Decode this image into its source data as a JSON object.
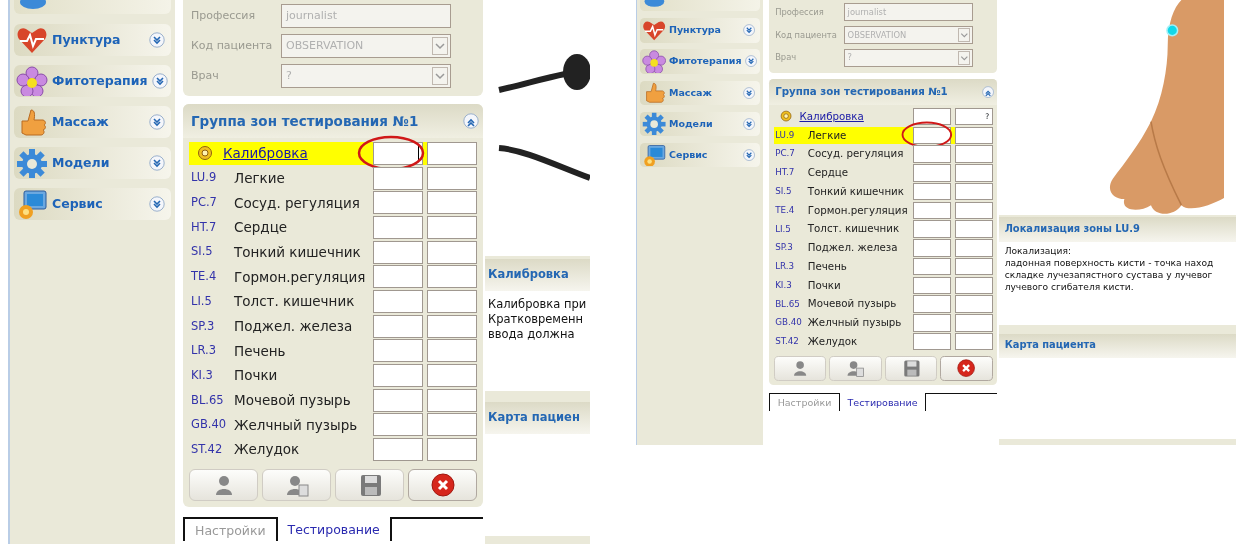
{
  "panels": [
    {
      "sidebar": {
        "items": [
          {
            "label": "Пунктура",
            "expanded": false
          },
          {
            "label": "Фитотерапия",
            "expanded": false
          },
          {
            "label": "Массаж",
            "expanded": false
          },
          {
            "label": "Модели",
            "expanded": false
          },
          {
            "label": "Сервис",
            "expanded": false
          }
        ]
      },
      "patient_form": {
        "fields": [
          {
            "label": "Профессия",
            "value": "journalist",
            "kind": "text",
            "disabled": true
          },
          {
            "label": "Код пациента",
            "value": "OBSERVATION",
            "kind": "select",
            "disabled": true
          },
          {
            "label": "Врач",
            "value": "?",
            "kind": "select",
            "disabled": true
          }
        ]
      },
      "test_group": {
        "title": "Группа зон тестирования №1",
        "expanded": true,
        "rows": [
          {
            "kind": "calibration",
            "label": "Калибровка",
            "highlighted": true,
            "circled": true,
            "focused": true
          },
          {
            "kind": "zone",
            "code": "LU.9",
            "name": "Легкие",
            "highlighted": false,
            "circled": false,
            "focused": false
          },
          {
            "kind": "zone",
            "code": "PC.7",
            "name": "Сосуд. регуляция",
            "highlighted": false,
            "circled": false,
            "focused": false
          },
          {
            "kind": "zone",
            "code": "HT.7",
            "name": "Сердце",
            "highlighted": false,
            "circled": false,
            "focused": false
          },
          {
            "kind": "zone",
            "code": "SI.5",
            "name": "Тонкий кишечник",
            "highlighted": false,
            "circled": false,
            "focused": false
          },
          {
            "kind": "zone",
            "code": "TE.4",
            "name": "Гормон.регуляция",
            "highlighted": false,
            "circled": false,
            "focused": false
          },
          {
            "kind": "zone",
            "code": "LI.5",
            "name": "Толст. кишечник",
            "highlighted": false,
            "circled": false,
            "focused": false
          },
          {
            "kind": "zone",
            "code": "SP.3",
            "name": "Поджел. железа",
            "highlighted": false,
            "circled": false,
            "focused": false
          },
          {
            "kind": "zone",
            "code": "LR.3",
            "name": "Печень",
            "highlighted": false,
            "circled": false,
            "focused": false
          },
          {
            "kind": "zone",
            "code": "KI.3",
            "name": "Почки",
            "highlighted": false,
            "circled": false,
            "focused": false
          },
          {
            "kind": "zone",
            "code": "BL.65",
            "name": "Мочевой пузырь",
            "highlighted": false,
            "circled": false,
            "focused": false
          },
          {
            "kind": "zone",
            "code": "GB.40",
            "name": "Желчный пузырь",
            "highlighted": false,
            "circled": false,
            "focused": false
          },
          {
            "kind": "zone",
            "code": "ST.42",
            "name": "Желудок",
            "highlighted": false,
            "circled": false,
            "focused": false
          }
        ]
      },
      "picture": {
        "kind": "cable"
      },
      "info_panels": [
        {
          "title": "Калибровка",
          "lines": [
            "Калибровка при",
            "Кратковременн",
            "ввода должна"
          ]
        },
        {
          "title": "Карта пациен"
        }
      ],
      "tabs": [
        {
          "label": "Настройки",
          "selected": false
        },
        {
          "label": "Тестирование",
          "selected": true
        }
      ]
    },
    {
      "sidebar": {
        "items": [
          {
            "label": "Пунктура",
            "expanded": false
          },
          {
            "label": "Фитотерапия",
            "expanded": false
          },
          {
            "label": "Массаж",
            "expanded": false
          },
          {
            "label": "Модели",
            "expanded": false
          },
          {
            "label": "Сервис",
            "expanded": false
          }
        ]
      },
      "patient_form": {
        "fields": [
          {
            "label": "Профессия",
            "value": "journalist",
            "kind": "text",
            "disabled": true
          },
          {
            "label": "Код пациента",
            "value": "OBSERVATION",
            "kind": "select",
            "disabled": true
          },
          {
            "label": "Врач",
            "value": "?",
            "kind": "select",
            "disabled": true
          }
        ]
      },
      "test_group": {
        "title": "Группа зон тестирования №1",
        "expanded": true,
        "rows": [
          {
            "kind": "calibration",
            "label": "Калибровка",
            "highlighted": false,
            "circled": false,
            "focused": false,
            "value_2": "?"
          },
          {
            "kind": "zone",
            "code": "LU.9",
            "name": "Легкие",
            "highlighted": true,
            "circled": true,
            "focused": false
          },
          {
            "kind": "zone",
            "code": "PC.7",
            "name": "Сосуд. регуляция",
            "highlighted": false,
            "circled": false,
            "focused": false
          },
          {
            "kind": "zone",
            "code": "HT.7",
            "name": "Сердце",
            "highlighted": false,
            "circled": false,
            "focused": false
          },
          {
            "kind": "zone",
            "code": "SI.5",
            "name": "Тонкий кишечник",
            "highlighted": false,
            "circled": false,
            "focused": false
          },
          {
            "kind": "zone",
            "code": "TE.4",
            "name": "Гормон.регуляция",
            "highlighted": false,
            "circled": false,
            "focused": false
          },
          {
            "kind": "zone",
            "code": "LI.5",
            "name": "Толст. кишечник",
            "highlighted": false,
            "circled": false,
            "focused": false
          },
          {
            "kind": "zone",
            "code": "SP.3",
            "name": "Поджел. железа",
            "highlighted": false,
            "circled": false,
            "focused": false
          },
          {
            "kind": "zone",
            "code": "LR.3",
            "name": "Печень",
            "highlighted": false,
            "circled": false,
            "focused": false
          },
          {
            "kind": "zone",
            "code": "KI.3",
            "name": "Почки",
            "highlighted": false,
            "circled": false,
            "focused": false
          },
          {
            "kind": "zone",
            "code": "BL.65",
            "name": "Мочевой пузырь",
            "highlighted": false,
            "circled": false,
            "focused": false
          },
          {
            "kind": "zone",
            "code": "GB.40",
            "name": "Желчный пузырь",
            "highlighted": false,
            "circled": false,
            "focused": false
          },
          {
            "kind": "zone",
            "code": "ST.42",
            "name": "Желудок",
            "highlighted": false,
            "circled": false,
            "focused": false
          }
        ]
      },
      "picture": {
        "kind": "hand"
      },
      "info_panels": [
        {
          "title": "Локализация зоны LU.9",
          "lines": [
            "Локализация:",
            "ладонная поверхность кисти - точка наход",
            "складке лучезапястного сустава у лучевог",
            "лучевого сгибателя кисти."
          ]
        },
        {
          "title": "Карта пациента"
        }
      ],
      "tabs": [
        {
          "label": "Настройки",
          "selected": false
        },
        {
          "label": "Тестирование",
          "selected": true
        }
      ]
    }
  ]
}
